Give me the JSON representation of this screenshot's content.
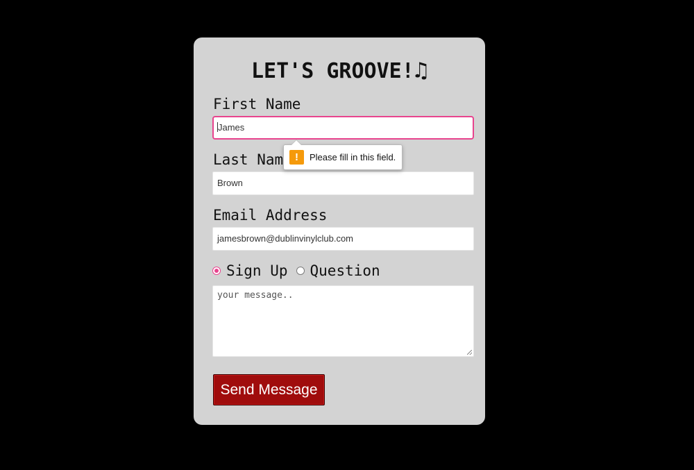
{
  "form": {
    "title": "LET'S GROOVE!",
    "title_icon": "♫",
    "first_name": {
      "label": "First Name",
      "value": "James"
    },
    "last_name": {
      "label": "Last Name",
      "value": "Brown"
    },
    "email": {
      "label": "Email Address",
      "value": "jamesbrown@dublinvinylclub.com"
    },
    "options": [
      {
        "label": "Sign Up",
        "checked": true
      },
      {
        "label": "Question",
        "checked": false
      }
    ],
    "message": {
      "placeholder": "your message.."
    },
    "submit_label": "Send Message"
  },
  "validation": {
    "icon": "!",
    "message": "Please fill in this field."
  },
  "colors": {
    "page_background": "#000000",
    "card_background": "#d3d3d3",
    "focus_accent": "#e8438e",
    "button_background": "#a00c0c",
    "warning_icon": "#f59a0b"
  }
}
